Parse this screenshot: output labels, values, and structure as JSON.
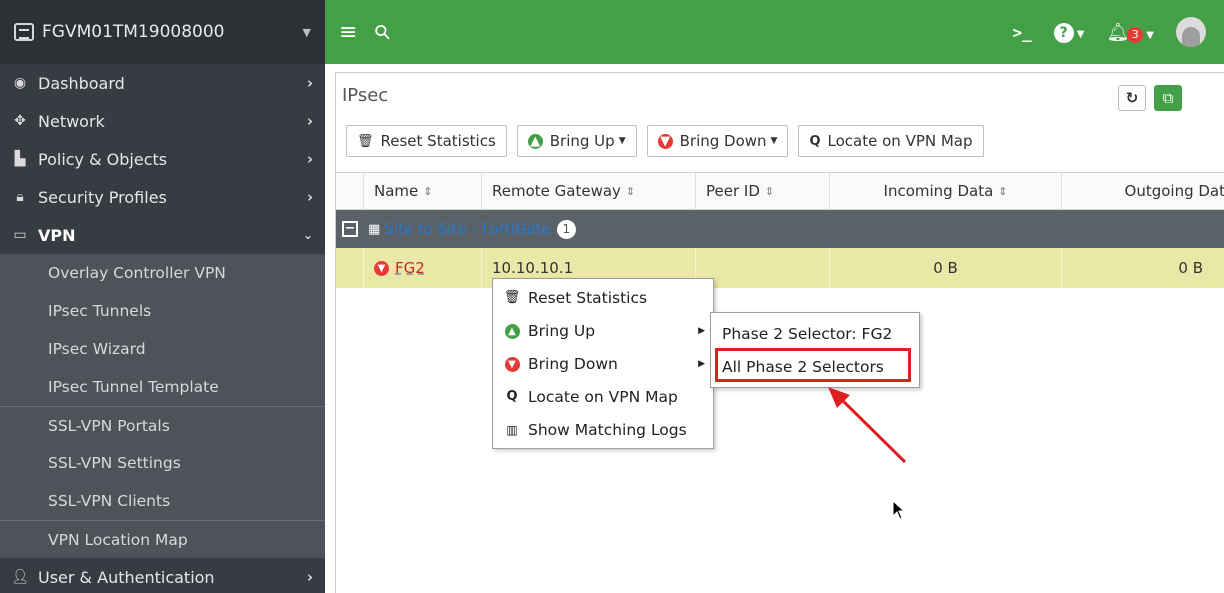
{
  "device": {
    "name": "FGVM01TM19008000"
  },
  "sidebar": {
    "items": [
      {
        "label": "Dashboard",
        "icon": "dashboard-icon"
      },
      {
        "label": "Network",
        "icon": "network-icon"
      },
      {
        "label": "Policy & Objects",
        "icon": "policy-icon"
      },
      {
        "label": "Security Profiles",
        "icon": "lock-icon"
      },
      {
        "label": "VPN",
        "icon": "laptop-icon",
        "expanded": true
      },
      {
        "label": "User & Authentication",
        "icon": "user-icon"
      }
    ],
    "vpn_sub": [
      "Overlay Controller VPN",
      "IPsec Tunnels",
      "IPsec Wizard",
      "IPsec Tunnel Template",
      "SSL-VPN Portals",
      "SSL-VPN Settings",
      "SSL-VPN Clients",
      "VPN Location Map"
    ]
  },
  "topbar": {
    "notification_count": "3",
    "accent": "#43a047"
  },
  "page": {
    "title": "IPsec"
  },
  "toolbar": {
    "reset": "Reset Statistics",
    "bring_up": "Bring Up",
    "bring_down": "Bring Down",
    "locate": "Locate on VPN Map"
  },
  "table": {
    "columns": [
      "Name",
      "Remote Gateway",
      "Peer ID",
      "Incoming Data",
      "Outgoing Dat"
    ],
    "group": {
      "label": "Site to Site - FortiGate",
      "count": "1"
    },
    "rows": [
      {
        "name": "FG2",
        "remote_gateway": "10.10.10.1",
        "peer_id": "",
        "incoming": "0 B",
        "outgoing": "0 B"
      }
    ]
  },
  "context_menu": {
    "items": [
      {
        "label": "Reset Statistics",
        "icon": "trash-icon"
      },
      {
        "label": "Bring Up",
        "icon": "arrow-up-circle-icon",
        "submenu": true
      },
      {
        "label": "Bring Down",
        "icon": "arrow-down-circle-icon",
        "submenu": true
      },
      {
        "label": "Locate on VPN Map",
        "icon": "search-icon"
      },
      {
        "label": "Show Matching Logs",
        "icon": "chart-icon"
      }
    ],
    "submenu": [
      "Phase 2 Selector: FG2",
      "All Phase 2 Selectors"
    ],
    "highlighted": "All Phase 2 Selectors",
    "highlight_color": "#e02020"
  }
}
